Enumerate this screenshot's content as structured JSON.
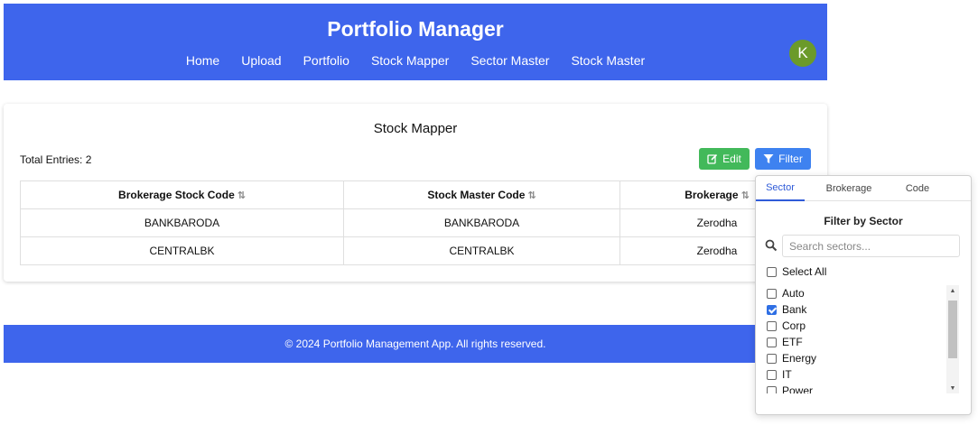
{
  "header": {
    "title": "Portfolio Manager",
    "nav": [
      "Home",
      "Upload",
      "Portfolio",
      "Stock Mapper",
      "Sector Master",
      "Stock Master"
    ],
    "avatar_initial": "K",
    "colors": {
      "header_bg": "#3e65ec",
      "avatar_bg": "#6b9a2a"
    }
  },
  "main": {
    "title": "Stock Mapper",
    "total_entries": "Total Entries: 2",
    "edit_label": "Edit",
    "filter_label": "Filter",
    "table": {
      "columns": [
        "Brokerage Stock Code",
        "Stock Master Code",
        "Brokerage"
      ],
      "rows": [
        [
          "BANKBARODA",
          "BANKBARODA",
          "Zerodha"
        ],
        [
          "CENTRALBK",
          "CENTRALBK",
          "Zerodha"
        ]
      ]
    }
  },
  "footer": {
    "text": "© 2024 Portfolio Management App. All rights reserved."
  },
  "filter_popover": {
    "tabs": [
      "Sector",
      "Brokerage",
      "Code"
    ],
    "active_tab": "Sector",
    "title": "Filter by Sector",
    "search_placeholder": "Search sectors...",
    "select_all_label": "Select All",
    "items": [
      {
        "label": "Auto",
        "checked": false
      },
      {
        "label": "Bank",
        "checked": true
      },
      {
        "label": "Corp",
        "checked": false
      },
      {
        "label": "ETF",
        "checked": false
      },
      {
        "label": "Energy",
        "checked": false
      },
      {
        "label": "IT",
        "checked": false
      },
      {
        "label": "Power",
        "checked": false
      }
    ]
  }
}
